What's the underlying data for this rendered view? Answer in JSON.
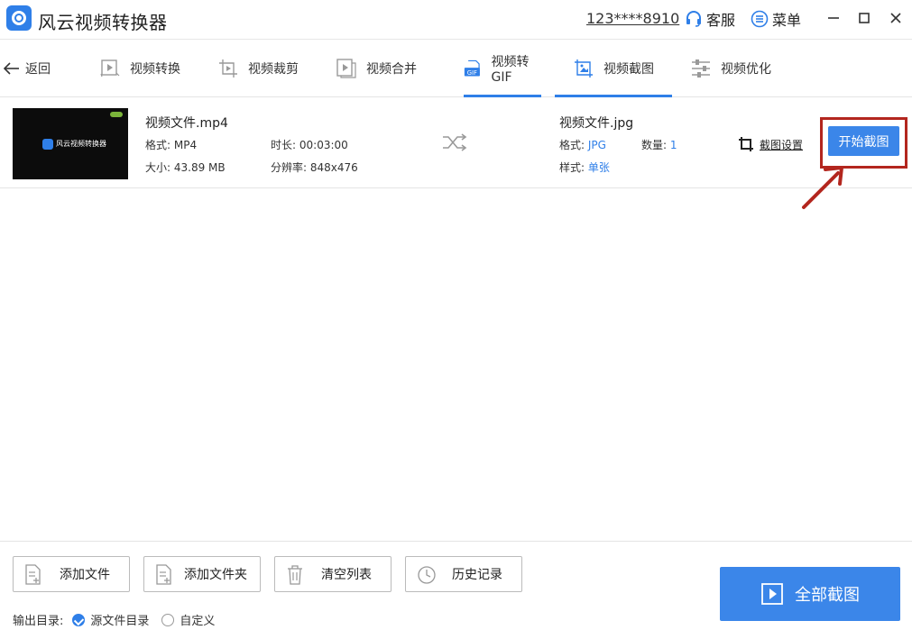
{
  "app": {
    "title": "风云视频转换器"
  },
  "titlebar": {
    "account": "123****8910",
    "service_label": "客服",
    "menu_label": "菜单"
  },
  "nav": {
    "back_label": "返回",
    "tabs": [
      {
        "label": "视频转换",
        "icon": "video-convert-icon",
        "active": false
      },
      {
        "label": "视频裁剪",
        "icon": "video-trim-icon",
        "active": false
      },
      {
        "label": "视频合并",
        "icon": "video-merge-icon",
        "active": false
      },
      {
        "label": "视频转GIF",
        "icon": "gif-icon",
        "active": true
      },
      {
        "label": "视频截图",
        "icon": "screenshot-icon",
        "active": true
      },
      {
        "label": "视频优化",
        "icon": "optimize-icon",
        "active": false
      }
    ]
  },
  "file": {
    "thumb_text": "风云视频转换器",
    "name": "视频文件.mp4",
    "format_label": "格式:",
    "format_value": "MP4",
    "duration_label": "时长:",
    "duration_value": "00:03:00",
    "size_label": "大小:",
    "size_value": "43.89 MB",
    "resolution_label": "分辨率:",
    "resolution_value": "848x476",
    "output_name": "视频文件.jpg",
    "out_format_label": "格式:",
    "out_format_value": "JPG",
    "count_label": "数量:",
    "count_value": "1",
    "style_label": "样式:",
    "style_value": "单张",
    "crop_settings_label": "截图设置",
    "start_button": "开始截图"
  },
  "footer": {
    "add_file": "添加文件",
    "add_folder": "添加文件夹",
    "clear_list": "清空列表",
    "history": "历史记录",
    "output_dir_label": "输出目录:",
    "option_source": "源文件目录",
    "option_custom": "自定义",
    "selected_option": "源文件目录",
    "all_capture": "全部截图"
  },
  "colors": {
    "accent": "#2f7fe8",
    "highlight_box": "#b3261e"
  }
}
